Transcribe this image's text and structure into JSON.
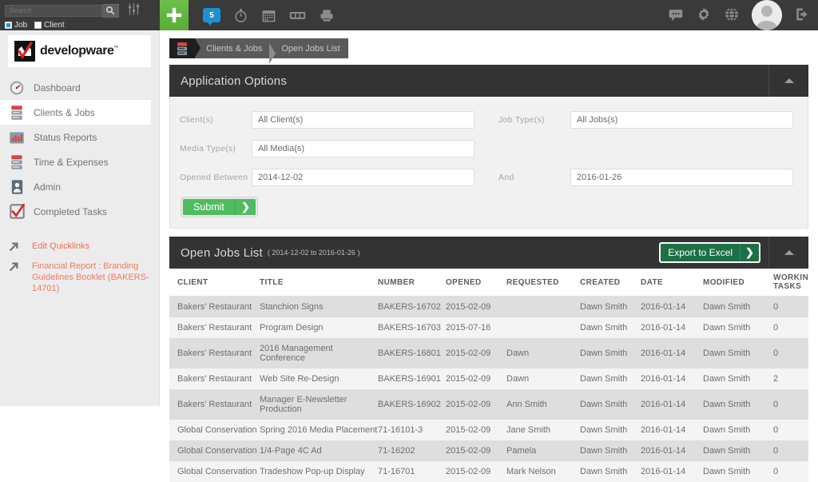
{
  "topbar": {
    "search": {
      "placeholder": "Search",
      "value": ""
    },
    "search_icon": "magnifier-icon",
    "filter_icon": "sliders-icon",
    "radios": [
      {
        "label": "Job",
        "selected": true
      },
      {
        "label": "Client",
        "selected": false
      }
    ],
    "add_icon": "plus-icon",
    "notification_count": "5",
    "icons": [
      "chat-bubble-icon",
      "stopwatch-icon",
      "calendar-icon",
      "filmstrip-icon",
      "printer-icon"
    ],
    "right_icons": [
      "comment-icon",
      "gear-icon",
      "globe-icon",
      "logout-icon"
    ],
    "avatar": "user-avatar"
  },
  "sidebar": {
    "logo_text": "developware",
    "logo_tm": "™",
    "items": [
      {
        "label": "Dashboard",
        "icon": "speedometer-icon",
        "active": false
      },
      {
        "label": "Clients & Jobs",
        "icon": "server-icon",
        "active": true
      },
      {
        "label": "Status Reports",
        "icon": "bar-chart-icon",
        "active": false
      },
      {
        "label": "Time & Expenses",
        "icon": "server-icon",
        "active": false
      },
      {
        "label": "Admin",
        "icon": "user-badge-icon",
        "active": false
      },
      {
        "label": "Completed Tasks",
        "icon": "checkbox-check-icon",
        "active": false
      }
    ],
    "quicklinks": [
      {
        "label": "Edit Quicklinks",
        "icon": "arrow-up-right-icon"
      },
      {
        "label": "Financial Report : Branding Guidelines Booklet (BAKERS-14701)",
        "icon": "arrow-up-right-icon"
      }
    ]
  },
  "breadcrumb": {
    "icon": "server-icon",
    "items": [
      "Clients & Jobs",
      "Open Jobs List"
    ]
  },
  "options_panel": {
    "title": "Application Options",
    "collapse_icon": "caret-up-icon",
    "fields": {
      "clients_label": "Client(s)",
      "clients_value": "All Client(s)",
      "media_label": "Media Type(s)",
      "media_value": "All Media(s)",
      "opened_label": "Opened Between",
      "opened_value": "2014-12-02",
      "jobtype_label": "Job Type(s)",
      "jobtype_value": "All Jobs(s)",
      "and_label": "And",
      "and_value": "2016-01-26"
    },
    "submit_label": "Submit",
    "submit_arrow": "❯"
  },
  "jobs_panel": {
    "title": "Open Jobs List",
    "subtitle": "( 2014-12-02 to 2016-01-26 )",
    "export_label": "Export to Excel",
    "export_arrow": "❯",
    "collapse_icon": "caret-up-icon",
    "columns": [
      "CLIENT",
      "TITLE",
      "NUMBER",
      "OPENED",
      "REQUESTED",
      "CREATED",
      "DATE",
      "MODIFIED",
      "WORKING TASKS"
    ],
    "rows": [
      {
        "client": "Bakers' Restaurant",
        "title": "Stanchion Signs",
        "number": "BAKERS-16702",
        "opened": "2015-02-09",
        "requested": "",
        "created": "Dawn Smith",
        "date": "2016-01-14",
        "modified": "Dawn Smith",
        "tasks": "0"
      },
      {
        "client": "Bakers' Restaurant",
        "title": "Program Design",
        "number": "BAKERS-16703",
        "opened": "2015-07-16",
        "requested": "",
        "created": "Dawn Smith",
        "date": "2016-01-14",
        "modified": "Dawn Smith",
        "tasks": "0"
      },
      {
        "client": "Bakers' Restaurant",
        "title": "2016 Management Conference",
        "number": "BAKERS-16801",
        "opened": "2015-02-09",
        "requested": "Dawn",
        "created": "Dawn Smith",
        "date": "2016-01-14",
        "modified": "Dawn Smith",
        "tasks": "0"
      },
      {
        "client": "Bakers' Restaurant",
        "title": "Web Site Re-Design",
        "number": "BAKERS-16901",
        "opened": "2015-02-09",
        "requested": "Dawn",
        "created": "Dawn Smith",
        "date": "2016-01-14",
        "modified": "Dawn Smith",
        "tasks": "2"
      },
      {
        "client": "Bakers' Restaurant",
        "title": "Manager E-Newsletter Production",
        "number": "BAKERS-16902",
        "opened": "2015-02-09",
        "requested": "Ann Smith",
        "created": "Dawn Smith",
        "date": "2016-01-14",
        "modified": "Dawn Smith",
        "tasks": "0"
      },
      {
        "client": "Global Conservation",
        "title": "Spring 2016 Media Placement",
        "number": "71-16101-3",
        "opened": "2015-02-09",
        "requested": "Jane Smith",
        "created": "Dawn Smith",
        "date": "2016-01-14",
        "modified": "Dawn Smith",
        "tasks": "0"
      },
      {
        "client": "Global Conservation",
        "title": "1/4-Page 4C Ad",
        "number": "71-16202",
        "opened": "2015-02-09",
        "requested": "Pamela",
        "created": "Dawn Smith",
        "date": "2016-01-14",
        "modified": "Dawn Smith",
        "tasks": "0"
      },
      {
        "client": "Global Conservation",
        "title": "Tradeshow Pop-up Display",
        "number": "71-16701",
        "opened": "2015-02-09",
        "requested": "Mark Nelson",
        "created": "Dawn Smith",
        "date": "2016-01-14",
        "modified": "Dawn Smith",
        "tasks": "0"
      }
    ]
  },
  "colors": {
    "accent_orange": "#ef6f55",
    "green_submit": "#4fbc5f",
    "green_export": "#1d7045",
    "topbar": "#3a3a3a",
    "panel_head": "#333333",
    "sidebar": "#ececec",
    "badge_blue": "#1e8fd0"
  }
}
